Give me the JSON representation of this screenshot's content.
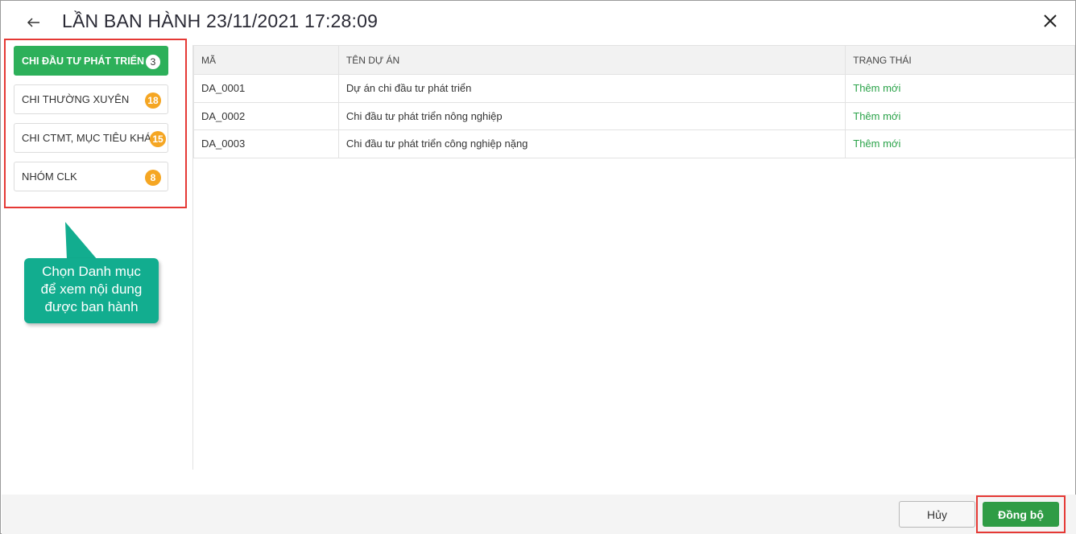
{
  "header": {
    "title": "LẦN BAN HÀNH 23/11/2021 17:28:09",
    "back_icon": "arrow-left-icon",
    "close_icon": "close-icon"
  },
  "sidebar": {
    "items": [
      {
        "label": "CHI ĐẦU TƯ PHÁT TRIỂN",
        "count": "3",
        "active": true
      },
      {
        "label": "CHI THƯỜNG XUYÊN",
        "count": "18",
        "active": false
      },
      {
        "label": "CHI CTMT, MỤC TIÊU KHÁC",
        "count": "15",
        "active": false
      },
      {
        "label": "NHÓM CLK",
        "count": "8",
        "active": false
      }
    ]
  },
  "callout": {
    "line1": "Chọn Danh mục",
    "line2": "để xem nội dung",
    "line3": "được ban hành"
  },
  "table": {
    "columns": [
      "MÃ",
      "TÊN DỰ ÁN",
      "TRẠNG THÁI"
    ],
    "rows": [
      [
        "DA_0001",
        "Dự án chi đầu tư phát triển",
        "Thêm mới"
      ],
      [
        "DA_0002",
        "Chi đầu tư phát triển nông nghiệp",
        "Thêm mới"
      ],
      [
        "DA_0003",
        "Chi đầu tư phát triển công nghiệp nặng",
        "Thêm mới"
      ]
    ]
  },
  "footer": {
    "cancel_label": "Hủy",
    "sync_label": "Đồng bộ"
  },
  "colors": {
    "active_category": "#2db05a",
    "badge": "#f5a623",
    "status_text": "#2ba34a",
    "callout": "#12ad8f",
    "highlight_border": "#e53935",
    "primary_button": "#2f9c45"
  }
}
